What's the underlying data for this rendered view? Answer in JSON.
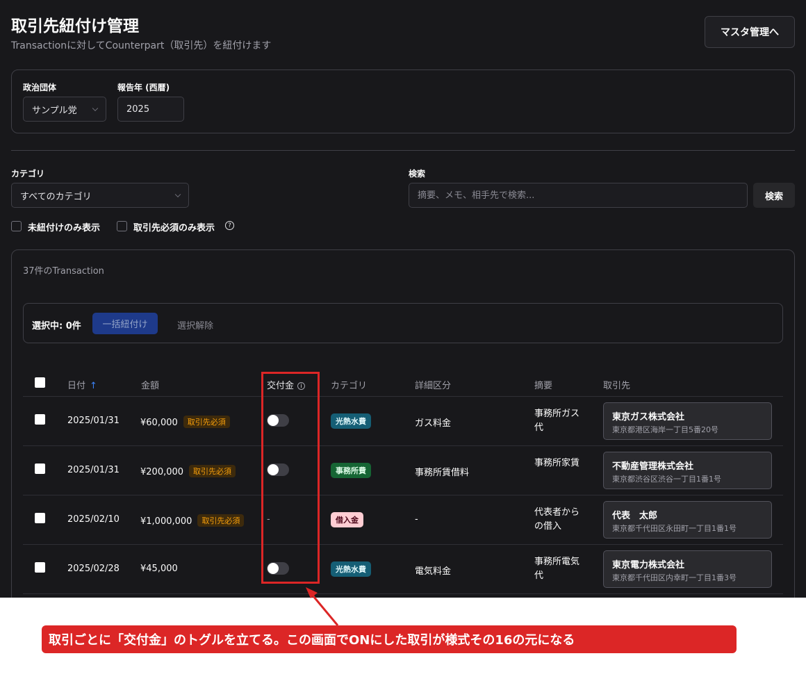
{
  "header": {
    "title": "取引先紐付け管理",
    "subtitle": "Transactionに対してCounterpart（取引先）を紐付けます",
    "master_button": "マスタ管理へ"
  },
  "filters": {
    "org_label": "政治団体",
    "org_value": "サンプル党",
    "year_label": "報告年 (西暦)",
    "year_value": "2025",
    "category_label": "カテゴリ",
    "category_value": "すべてのカテゴリ",
    "search_label": "検索",
    "search_placeholder": "摘要、メモ、相手先で検索...",
    "search_button": "検索",
    "unlinked_only": "未紐付けのみ表示",
    "required_only": "取引先必須のみ表示",
    "help_glyph": "?"
  },
  "list": {
    "count_text": "37件のTransaction",
    "selected_text": "選択中: 0件",
    "bulk_link_button": "一括紐付け",
    "clear_selection": "選択解除"
  },
  "table": {
    "headers": {
      "date": "日付",
      "sort_arrow": "↑",
      "amount": "金額",
      "subsidy": "交付金",
      "info_glyph": "i",
      "category": "カテゴリ",
      "detail": "詳細区分",
      "summary": "摘要",
      "counterpart": "取引先"
    },
    "rows": [
      {
        "date": "2025/01/31",
        "amount": "¥60,000",
        "required_badge": "取引先必須",
        "subsidy": "toggle-off",
        "category": "光熱水費",
        "detail": "ガス料金",
        "summary": "事務所ガス代",
        "counterpart_name": "東京ガス株式会社",
        "counterpart_address": "東京都港区海岸一丁目5番20号"
      },
      {
        "date": "2025/01/31",
        "amount": "¥200,000",
        "required_badge": "取引先必須",
        "subsidy": "toggle-off",
        "category": "事務所費",
        "detail": "事務所賃借料",
        "summary": "事務所家賃",
        "counterpart_name": "不動産管理株式会社",
        "counterpart_address": "東京都渋谷区渋谷一丁目1番1号"
      },
      {
        "date": "2025/02/10",
        "amount": "¥1,000,000",
        "required_badge": "取引先必須",
        "subsidy": "-",
        "category": "借入金",
        "detail": "-",
        "summary": "代表者からの借入",
        "counterpart_name": "代表　太郎",
        "counterpart_address": "東京都千代田区永田町一丁目1番1号"
      },
      {
        "date": "2025/02/28",
        "amount": "¥45,000",
        "subsidy": "toggle-off",
        "category": "光熱水費",
        "detail": "電気料金",
        "summary": "事務所電気代",
        "counterpart_name": "東京電力株式会社",
        "counterpart_address": "東京都千代田区内幸町一丁目1番3号"
      }
    ]
  },
  "annotation": {
    "callout": "取引ごとに「交付金」のトグルを立てる。この画面でONにした取引が様式その16の元になる"
  },
  "colors": {
    "background": "#18181b",
    "accent_blue": "#1e3a8a",
    "highlight_red": "#dc2626",
    "badge_utilities": "#155e75",
    "badge_office": "#166534",
    "badge_loan": "#fecdd3",
    "badge_required": "#f59e0b"
  }
}
